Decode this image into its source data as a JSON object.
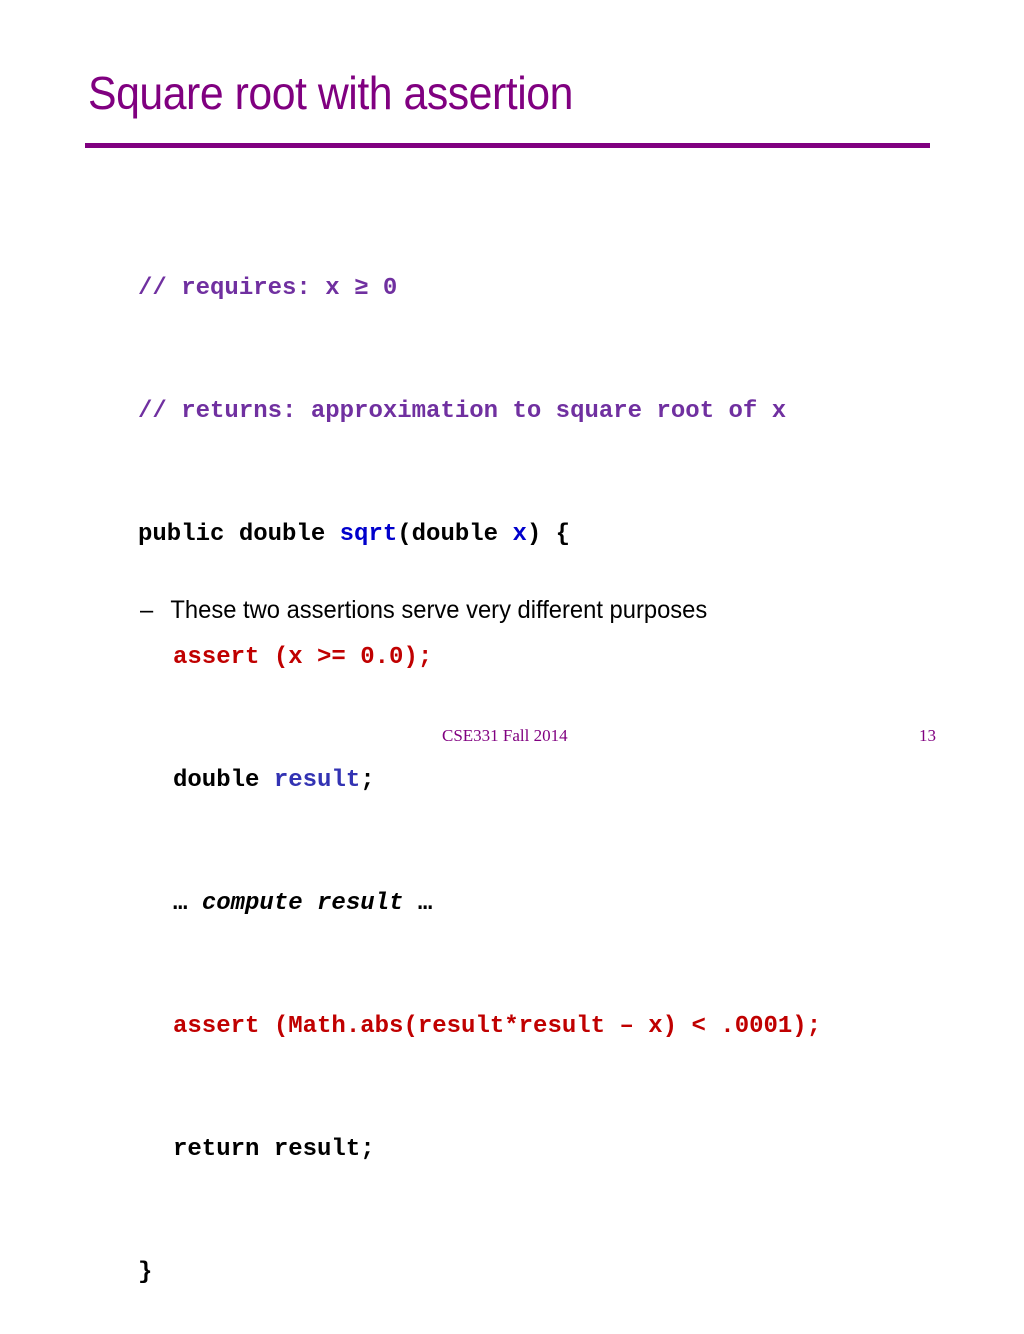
{
  "slide": {
    "title": "Square root with assertion",
    "colors": {
      "title": "#800080",
      "comment": "#7030a0",
      "identifier": "#0000cc",
      "assert": "#c00000",
      "footer": "#800080"
    },
    "code": {
      "line1": "// requires: x ≥ 0",
      "line2": "// returns: approximation to square root of x",
      "line3": {
        "kw": "public double ",
        "name": "sqrt",
        "open": "(double ",
        "param": "x",
        "close": ") {"
      },
      "line4": "assert (x >= 0.0);",
      "line5": {
        "kw": "double ",
        "var": "result",
        "semi": ";"
      },
      "line6": {
        "pre": "… ",
        "mid": "compute result",
        "post": " …"
      },
      "line7": "assert (Math.abs(result*result – x) < .0001);",
      "line8": "return result;",
      "line9": "}"
    },
    "bullet": {
      "dash": "–",
      "text": "These two assertions serve very different purposes"
    },
    "footer": {
      "course": "CSE331 Fall 2014",
      "page_number": "13"
    }
  }
}
